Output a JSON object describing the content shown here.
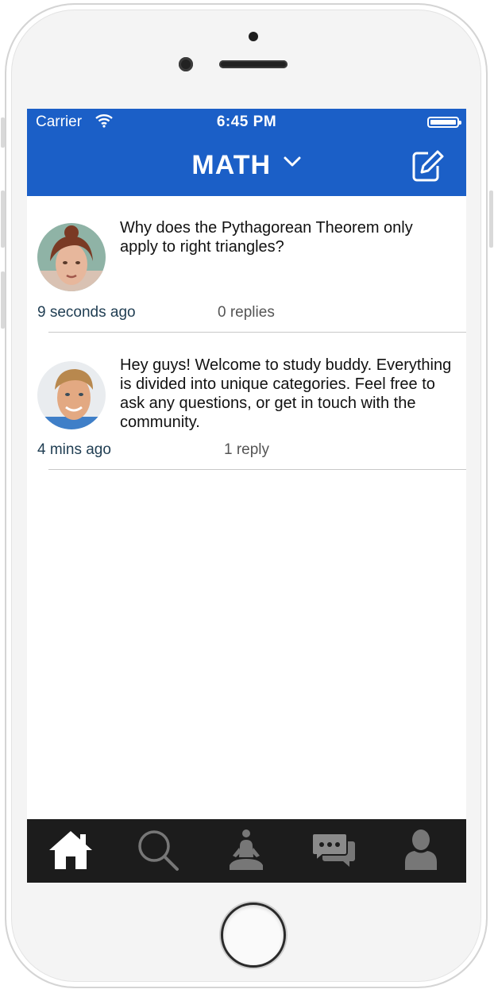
{
  "status_bar": {
    "carrier": "Carrier",
    "time": "6:45 PM"
  },
  "nav": {
    "title": "MATH"
  },
  "posts": [
    {
      "text": "Why does the Pythagorean Theorem only apply to right triangles?",
      "time": "9 seconds ago",
      "replies": "0 replies"
    },
    {
      "text": "Hey guys! Welcome to study buddy. Everything is divided into unique categories. Feel free to ask any questions, or get in touch with the community.",
      "time": "4 mins ago",
      "replies": "1 reply"
    }
  ],
  "tab_bar": {
    "items": [
      "home-icon",
      "search-icon",
      "meditation-icon",
      "chat-icon",
      "profile-icon"
    ],
    "active": "home-icon"
  },
  "colors": {
    "accent": "#1b5fc7",
    "tab_bar": "#1c1c1c",
    "tab_active": "#ffffff",
    "tab_inactive": "#777777"
  }
}
